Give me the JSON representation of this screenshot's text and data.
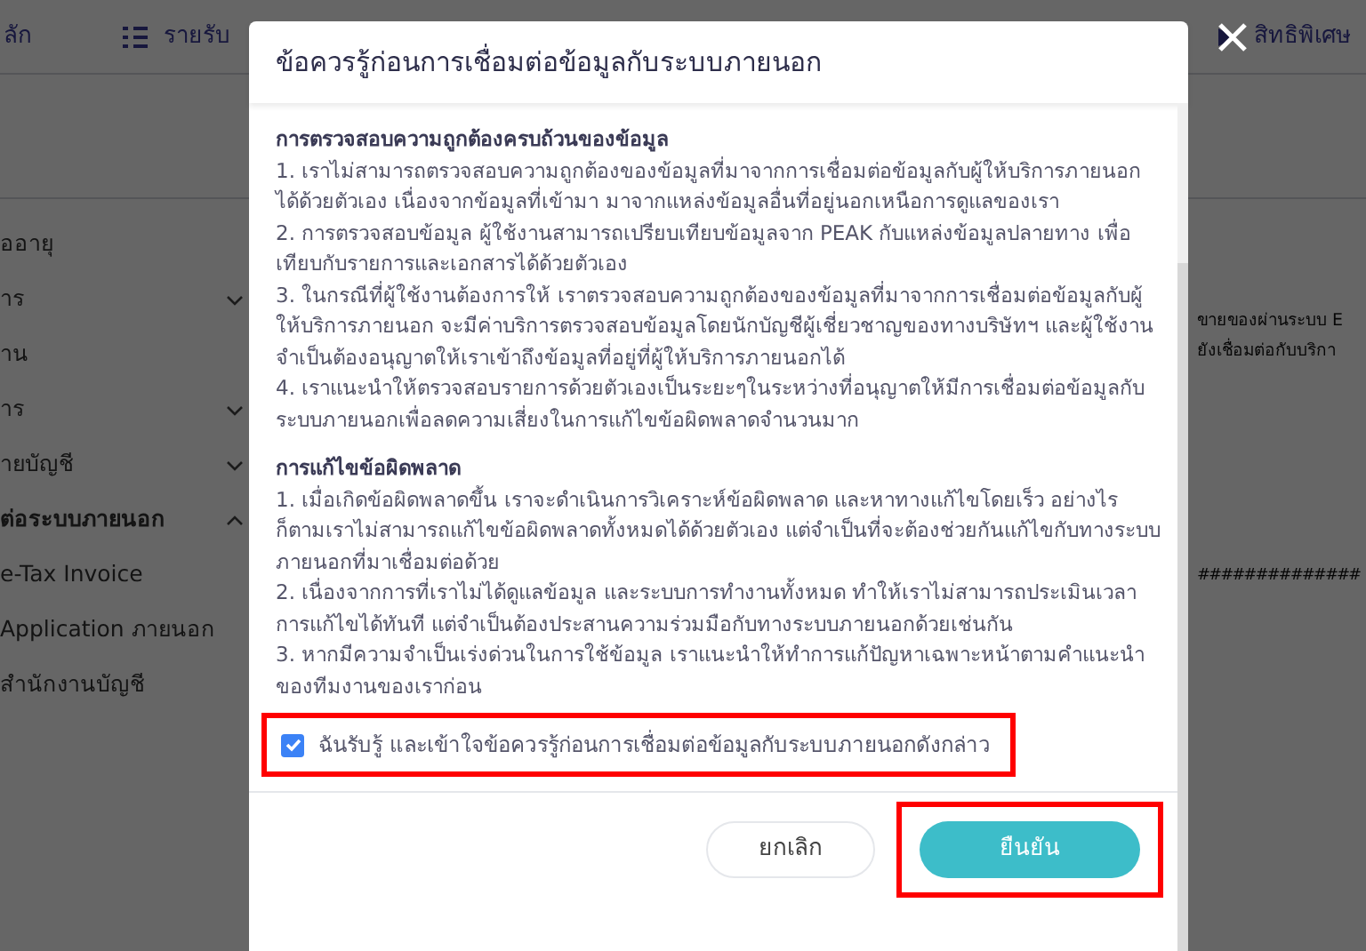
{
  "nav": {
    "items": [
      "ลัก",
      "รายรับ",
      "สิทธิพิเศษ"
    ]
  },
  "sidebar": {
    "items": [
      {
        "label": "ออายุ",
        "kind": "link"
      },
      {
        "label": "าร",
        "kind": "group",
        "expanded": false
      },
      {
        "label": "าน",
        "kind": "link"
      },
      {
        "label": "าร",
        "kind": "group",
        "expanded": false
      },
      {
        "label": "ายบัญชี",
        "kind": "group",
        "expanded": false
      },
      {
        "label": "ต่อระบบภายนอก",
        "kind": "group",
        "expanded": true
      },
      {
        "label": "e-Tax Invoice",
        "kind": "link"
      },
      {
        "label": "Application ภายนอก",
        "kind": "link"
      },
      {
        "label": "สำนักงานบัญชี",
        "kind": "link"
      }
    ]
  },
  "background_text": [
    "ขายของผ่านระบบ E",
    "ยังเชื่อมต่อกับบริกา",
    "##############"
  ],
  "dialog": {
    "title": "ข้อควรรู้ก่อนการเชื่อมต่อข้อมูลกับระบบภายนอก",
    "sections": [
      {
        "heading": "การตรวจสอบความถูกต้องครบถ้วนของข้อมูล",
        "items": [
          "1. เราไม่สามารถตรวจสอบความถูกต้องของข้อมูลที่มาจากการเชื่อมต่อข้อมูลกับผู้ให้บริการภายนอกได้ด้วยตัวเอง เนื่องจากข้อมูลที่เข้ามา มาจากแหล่งข้อมูลอื่นที่อยู่นอกเหนือการดูแลของเรา",
          "2. การตรวจสอบข้อมูล ผู้ใช้งานสามารถเปรียบเทียบข้อมูลจาก PEAK กับแหล่งข้อมูลปลายทาง เพื่อเทียบกับรายการและเอกสารได้ด้วยตัวเอง",
          "3. ในกรณีที่ผู้ใช้งานต้องการให้ เราตรวจสอบความถูกต้องของข้อมูลที่มาจากการเชื่อมต่อข้อมูลกับผู้ให้บริการภายนอก จะมีค่าบริการตรวจสอบข้อมูลโดยนักบัญชีผู้เชี่ยวชาญของทางบริษัทฯ และผู้ใช้งานจำเป็นต้องอนุญาตให้เราเข้าถึงข้อมูลที่อยู่ที่ผู้ให้บริการภายนอกได้",
          "4. เราแนะนำให้ตรวจสอบรายการด้วยตัวเองเป็นระยะๆในระหว่างที่อนุญาตให้มีการเชื่อมต่อข้อมูลกับระบบภายนอกเพื่อลดความเสี่ยงในการแก้ไขข้อผิดพลาดจำนวนมาก"
        ]
      },
      {
        "heading": "การแก้ไขข้อผิดพลาด",
        "items": [
          "1. เมื่อเกิดข้อผิดพลาดขึ้น เราจะดำเนินการวิเคราะห์ข้อผิดพลาด และหาทางแก้ไขโดยเร็ว อย่างไรก็ตามเราไม่สามารถแก้ไขข้อผิดพลาดทั้งหมดได้ด้วยตัวเอง แต่จำเป็นที่จะต้องช่วยกันแก้ไขกับทางระบบภายนอกที่มาเชื่อมต่อด้วย",
          "2. เนื่องจากการที่เราไม่ได้ดูแลข้อมูล และระบบการทำงานทั้งหมด ทำให้เราไม่สามารถประเมินเวลาการแก้ไขได้ทันที แต่จำเป็นต้องประสานความร่วมมือกับทางระบบภายนอกด้วยเช่นกัน",
          "3. หากมีความจำเป็นเร่งด่วนในการใช้ข้อมูล เราแนะนำให้ทำการแก้ปัญหาเฉพาะหน้าตามคำแนะนำของทีมงานของเราก่อน"
        ]
      }
    ],
    "agreement": {
      "label": "ฉันรับรู้ และเข้าใจข้อควรรู้ก่อนการเชื่อมต่อข้อมูลกับระบบภายนอกดังกล่าว",
      "checked": true,
      "highlighted": true
    },
    "buttons": [
      {
        "label": "ยกเลิก",
        "kind": "secondary",
        "highlighted": false
      },
      {
        "label": "ยืนยัน",
        "kind": "primary",
        "highlighted": true
      }
    ]
  }
}
